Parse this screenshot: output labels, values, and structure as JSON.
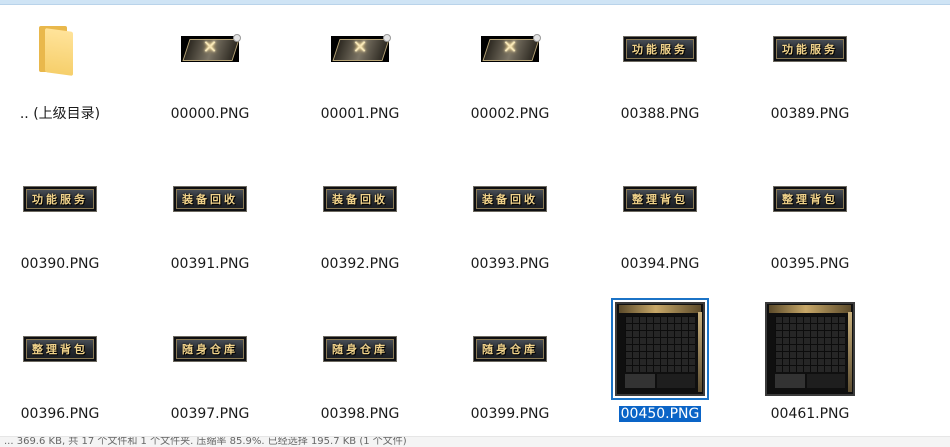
{
  "files": [
    {
      "name": ".. (上级目录)",
      "kind": "folder-up"
    },
    {
      "name": "00000.PNG",
      "kind": "close"
    },
    {
      "name": "00001.PNG",
      "kind": "close"
    },
    {
      "name": "00002.PNG",
      "kind": "close"
    },
    {
      "name": "00388.PNG",
      "kind": "button",
      "button_text": "功能服务"
    },
    {
      "name": "00389.PNG",
      "kind": "button",
      "button_text": "功能服务"
    },
    {
      "name": "00390.PNG",
      "kind": "button",
      "button_text": "功能服务"
    },
    {
      "name": "00391.PNG",
      "kind": "button",
      "button_text": "装备回收"
    },
    {
      "name": "00392.PNG",
      "kind": "button",
      "button_text": "装备回收"
    },
    {
      "name": "00393.PNG",
      "kind": "button",
      "button_text": "装备回收"
    },
    {
      "name": "00394.PNG",
      "kind": "button",
      "button_text": "整理背包"
    },
    {
      "name": "00395.PNG",
      "kind": "button",
      "button_text": "整理背包"
    },
    {
      "name": "00396.PNG",
      "kind": "button",
      "button_text": "整理背包"
    },
    {
      "name": "00397.PNG",
      "kind": "button",
      "button_text": "随身仓库"
    },
    {
      "name": "00398.PNG",
      "kind": "button",
      "button_text": "随身仓库"
    },
    {
      "name": "00399.PNG",
      "kind": "button",
      "button_text": "随身仓库"
    },
    {
      "name": "00450.PNG",
      "kind": "inventory",
      "selected": true
    },
    {
      "name": "00461.PNG",
      "kind": "inventory"
    }
  ],
  "colors": {
    "selection": "#0a64c7",
    "selection_outline": "#1b73c6",
    "button_text": "#f1d38b"
  },
  "status_text": "... 369.6 KB, 共 17 个文件和 1 个文件夹. 压缩率 85.9%. 已经选择 195.7 KB (1 个文件)"
}
